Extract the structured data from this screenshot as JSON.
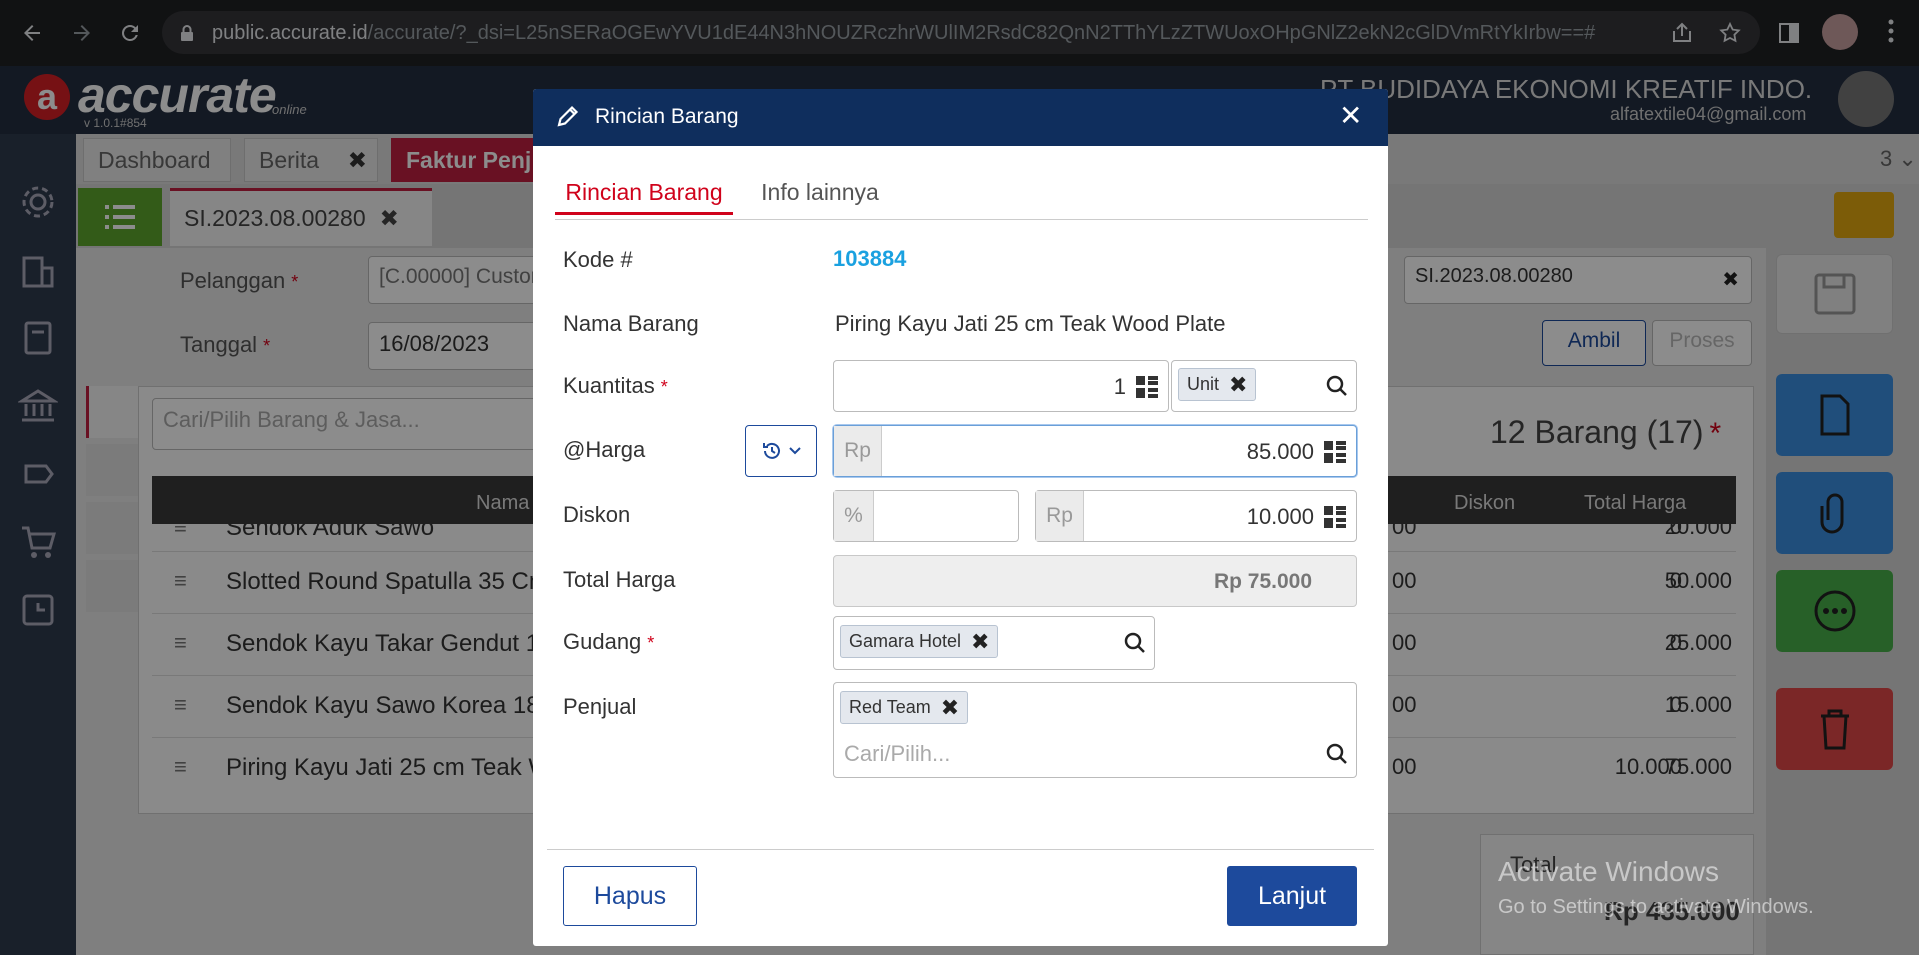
{
  "browser": {
    "url_host": "public.accurate.id",
    "url_path": "/accurate/?_dsi=L25nSERaOGEwYVU1dE44N3hNOUZRczhrWUlIM2RsdC82QnN2TThYLzZTWUoxOHpGNlZ2ekN2cGlDVmRtYkIrbw==#"
  },
  "app": {
    "logo_text": "accurate",
    "logo_online": "online",
    "version": "v 1.0.1#854",
    "company": "PT BUDIDAYA EKONOMI KREATIF INDO...",
    "email": "alfatextile04@gmail.com",
    "tab_counter": "3"
  },
  "top_tabs": [
    {
      "label": "Dashboard"
    },
    {
      "label": "Berita"
    },
    {
      "label": "Faktur Penj"
    }
  ],
  "doc_tab": "SI.2023.08.00280",
  "form": {
    "pelanggan_label": "Pelanggan",
    "pelanggan_value": "[C.00000] Custom",
    "tanggal_label": "Tanggal",
    "tanggal_value": "16/08/2023",
    "nomor_value": "SI.2023.08.00280",
    "ambil_label": "Ambil",
    "proses_label": "Proses",
    "search_placeholder": "Cari/Pilih Barang & Jasa...",
    "summary": "12 Barang (17)",
    "columns": {
      "nama": "Nama",
      "diskon": "Diskon",
      "total": "Total Harga"
    },
    "rows": [
      {
        "name": "Sendok Aduk Sawo",
        "price": "00",
        "diskon": "0",
        "total": "20.000"
      },
      {
        "name": "Slotted Round Spatulla 35 Cm",
        "price": "00",
        "diskon": "0",
        "total": "50.000"
      },
      {
        "name": "Sendok Kayu Takar Gendut 13",
        "price": "00",
        "diskon": "0",
        "total": "25.000"
      },
      {
        "name": "Sendok Kayu Sawo Korea 180",
        "price": "00",
        "diskon": "0",
        "total": "15.000"
      },
      {
        "name": "Piring Kayu Jati 25 cm Teak W",
        "price": "00",
        "diskon": "10.000",
        "total": "75.000"
      }
    ],
    "total_label": "Total",
    "total_value": "Rp 435.000"
  },
  "watermark": {
    "line1": "Activate Windows",
    "line2": "Go to Settings to activate Windows."
  },
  "dialog": {
    "title": "Rincian Barang",
    "tabs": [
      {
        "label": "Rincian Barang",
        "active": true
      },
      {
        "label": "Info lainnya",
        "active": false
      }
    ],
    "kode_label": "Kode #",
    "kode_value": "103884",
    "nama_label": "Nama Barang",
    "nama_value": "Piring Kayu Jati 25 cm Teak Wood Plate",
    "kuantitas_label": "Kuantitas",
    "kuantitas_value": "1",
    "unit_tag": "Unit",
    "harga_label": "@Harga",
    "harga_prefix": "Rp",
    "harga_value": "85.000",
    "diskon_label": "Diskon",
    "diskon_pct_prefix": "%",
    "diskon_pct_value": "",
    "diskon_rp_prefix": "Rp",
    "diskon_rp_value": "10.000",
    "total_label": "Total Harga",
    "total_value": "Rp 75.000",
    "gudang_label": "Gudang",
    "gudang_tag": "Gamara Hotel",
    "penjual_label": "Penjual",
    "penjual_tag": "Red Team",
    "penjual_placeholder": "Cari/Pilih...",
    "hapus_label": "Hapus",
    "lanjut_label": "Lanjut",
    "required_mark": "*"
  },
  "colors": {
    "dialog_header": "#0f2e5d",
    "accent_red": "#d0021b",
    "link_blue": "#1aa1e0",
    "primary_button": "#1d4a9c"
  }
}
